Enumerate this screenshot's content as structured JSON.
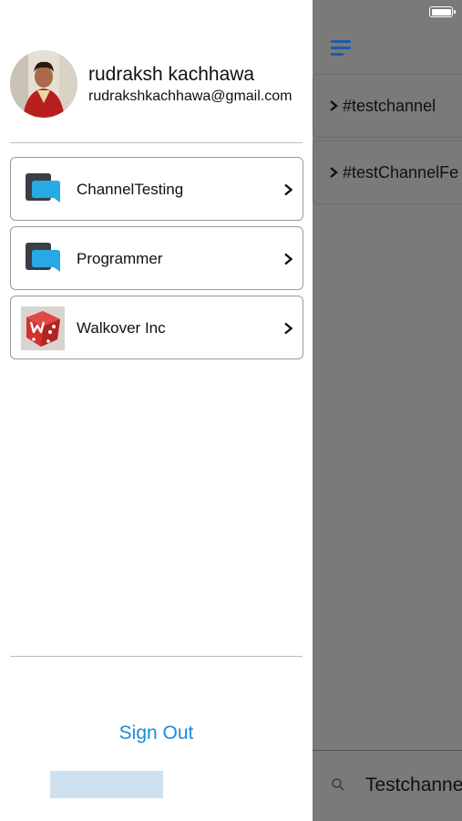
{
  "user": {
    "name": "rudraksh kachhawa",
    "email": "rudrakshkachhawa@gmail.com"
  },
  "teams": [
    {
      "name": "ChannelTesting",
      "logo": "chat-bubble-logo"
    },
    {
      "name": "Programmer",
      "logo": "chat-bubble-logo"
    },
    {
      "name": "Walkover Inc",
      "logo": "red-dice-logo"
    }
  ],
  "sign_out_label": "Sign Out",
  "main": {
    "channels": [
      {
        "name": "#testchannel"
      },
      {
        "name": "#testChannelFe"
      }
    ],
    "search_value": "Testchannel"
  },
  "colors": {
    "accent": "#1a8cde",
    "menu_icon": "#1f5aa8",
    "overlay": "#7a7a7a",
    "logo_blue": "#29a8e6",
    "logo_dark": "#3a3f45",
    "dice_red": "#d0322f"
  }
}
